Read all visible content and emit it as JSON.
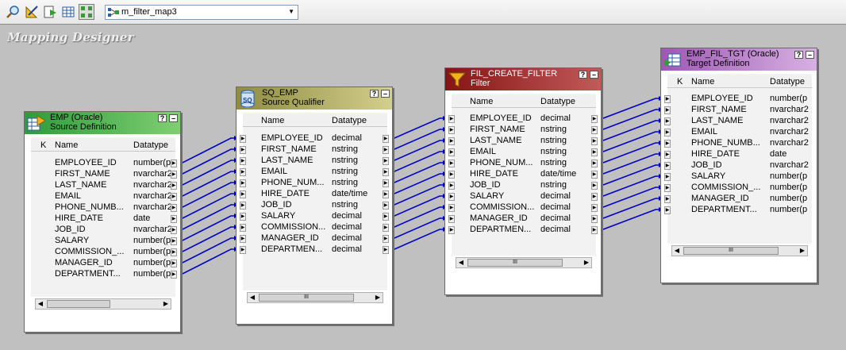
{
  "toolbar": {
    "buttons": [
      "find-icon",
      "arrange-icon",
      "validate-icon",
      "table-icon",
      "grid-icon"
    ],
    "mapping_select": {
      "value": "m_filter_map3"
    }
  },
  "canvas": {
    "title": "Mapping Designer"
  },
  "colors": {
    "source_title": "#3ea84a",
    "qualifier_title": "#a8a461",
    "filter_title": "#8c1c1c",
    "target_title": "#a462b6",
    "link": "#0000cc"
  },
  "transforms": [
    {
      "id": "emp",
      "name": "EMP (Oracle)",
      "subtitle": "Source Definition",
      "help": "?",
      "min": "–",
      "key_header": "K",
      "name_header": "Name",
      "type_header": "Datatype",
      "rows": [
        [
          "EMPLOYEE_ID",
          "number(p"
        ],
        [
          "FIRST_NAME",
          "nvarchar2"
        ],
        [
          "LAST_NAME",
          "nvarchar2"
        ],
        [
          "EMAIL",
          "nvarchar2"
        ],
        [
          "PHONE_NUMB...",
          "nvarchar2"
        ],
        [
          "HIRE_DATE",
          "date"
        ],
        [
          "JOB_ID",
          "nvarchar2"
        ],
        [
          "SALARY",
          "number(p"
        ],
        [
          "COMMISSION_...",
          "number(p"
        ],
        [
          "MANAGER_ID",
          "number(p"
        ],
        [
          "DEPARTMENT...",
          "number(p"
        ]
      ]
    },
    {
      "id": "sq",
      "name": "SQ_EMP",
      "subtitle": "Source Qualifier",
      "help": "?",
      "min": "–",
      "name_header": "Name",
      "type_header": "Datatype",
      "rows": [
        [
          "EMPLOYEE_ID",
          "decimal"
        ],
        [
          "FIRST_NAME",
          "nstring"
        ],
        [
          "LAST_NAME",
          "nstring"
        ],
        [
          "EMAIL",
          "nstring"
        ],
        [
          "PHONE_NUM...",
          "nstring"
        ],
        [
          "HIRE_DATE",
          "date/time"
        ],
        [
          "JOB_ID",
          "nstring"
        ],
        [
          "SALARY",
          "decimal"
        ],
        [
          "COMMISSION...",
          "decimal"
        ],
        [
          "MANAGER_ID",
          "decimal"
        ],
        [
          "DEPARTMEN...",
          "decimal"
        ]
      ]
    },
    {
      "id": "fil",
      "name": "FIL_CREATE_FILTER",
      "subtitle": "Filter",
      "help": "?",
      "min": "–",
      "name_header": "Name",
      "type_header": "Datatype",
      "rows": [
        [
          "EMPLOYEE_ID",
          "decimal"
        ],
        [
          "FIRST_NAME",
          "nstring"
        ],
        [
          "LAST_NAME",
          "nstring"
        ],
        [
          "EMAIL",
          "nstring"
        ],
        [
          "PHONE_NUM...",
          "nstring"
        ],
        [
          "HIRE_DATE",
          "date/time"
        ],
        [
          "JOB_ID",
          "nstring"
        ],
        [
          "SALARY",
          "decimal"
        ],
        [
          "COMMISSION...",
          "decimal"
        ],
        [
          "MANAGER_ID",
          "decimal"
        ],
        [
          "DEPARTMEN...",
          "decimal"
        ]
      ]
    },
    {
      "id": "tgt",
      "name": "EMP_FIL_TGT (Oracle)",
      "subtitle": "Target Definition",
      "help": "?",
      "min": "–",
      "key_header": "K",
      "name_header": "Name",
      "type_header": "Datatype",
      "rows": [
        [
          "EMPLOYEE_ID",
          "number(p"
        ],
        [
          "FIRST_NAME",
          "nvarchar2"
        ],
        [
          "LAST_NAME",
          "nvarchar2"
        ],
        [
          "EMAIL",
          "nvarchar2"
        ],
        [
          "PHONE_NUMB...",
          "nvarchar2"
        ],
        [
          "HIRE_DATE",
          "date"
        ],
        [
          "JOB_ID",
          "nvarchar2"
        ],
        [
          "SALARY",
          "number(p"
        ],
        [
          "COMMISSION_...",
          "number(p"
        ],
        [
          "MANAGER_ID",
          "number(p"
        ],
        [
          "DEPARTMENT...",
          "number(p"
        ]
      ]
    }
  ],
  "scroll": {
    "left": "◀",
    "right": "▶",
    "thumb": "III"
  }
}
